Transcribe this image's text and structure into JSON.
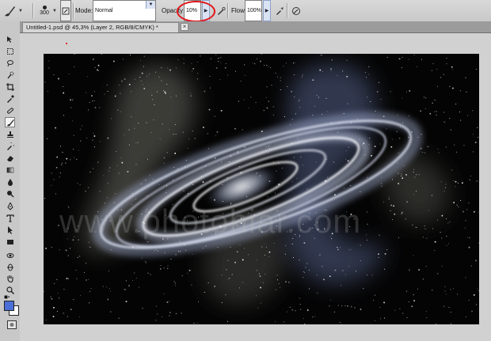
{
  "options_bar": {
    "brush_size": "300",
    "mode_label": "Mode:",
    "mode_value": "Normal",
    "opacity_label": "Opacity:",
    "opacity_value": "10%",
    "flow_label": "Flow:",
    "flow_value": "100%"
  },
  "document_tab": {
    "title": "Untitled-1.psd @ 45,3% (Layer 2, RGB/8/CMYK) *",
    "close_glyph": "×"
  },
  "colors": {
    "foreground": "#4a6fd6",
    "background": "#ffffff",
    "highlight_ring": "#e0161b"
  },
  "canvas": {
    "watermark": "www.photohiar.com"
  },
  "icons": {
    "tool_preset": "brush-icon",
    "brush_panel": "brush-panel-icon",
    "airbrush": "airbrush-icon",
    "tablet_pressure": "tablet-pressure-icon"
  }
}
